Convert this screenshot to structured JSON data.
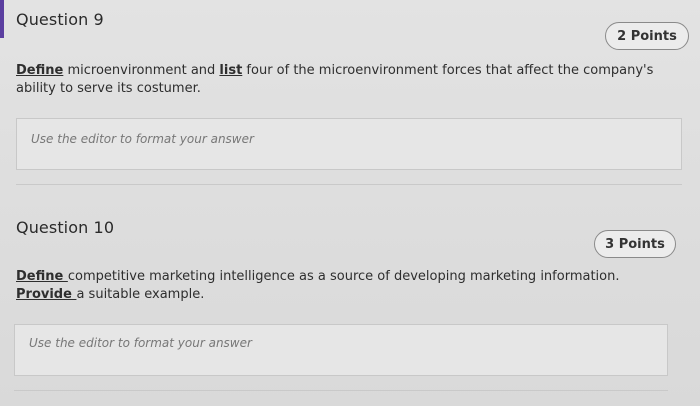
{
  "questions": [
    {
      "title": "Question 9",
      "points": "2 Points",
      "prompt": {
        "verb1": "Define",
        "text1": " microenvironment and ",
        "verb2": "list",
        "text2": " four of the microenvironment forces that affect the company's ability to serve its costumer."
      },
      "editor_placeholder": "Use the editor to format your answer"
    },
    {
      "title": "Question 10",
      "points": "3 Points",
      "prompt": {
        "verb1": "Define ",
        "text1": "competitive marketing intelligence as a source of developing marketing information. ",
        "verb2": "Provide ",
        "text2": "a suitable example."
      },
      "editor_placeholder": "Use the editor to format your answer"
    }
  ],
  "colors": {
    "accent": "#5b3fa0",
    "background": "#dedede"
  }
}
